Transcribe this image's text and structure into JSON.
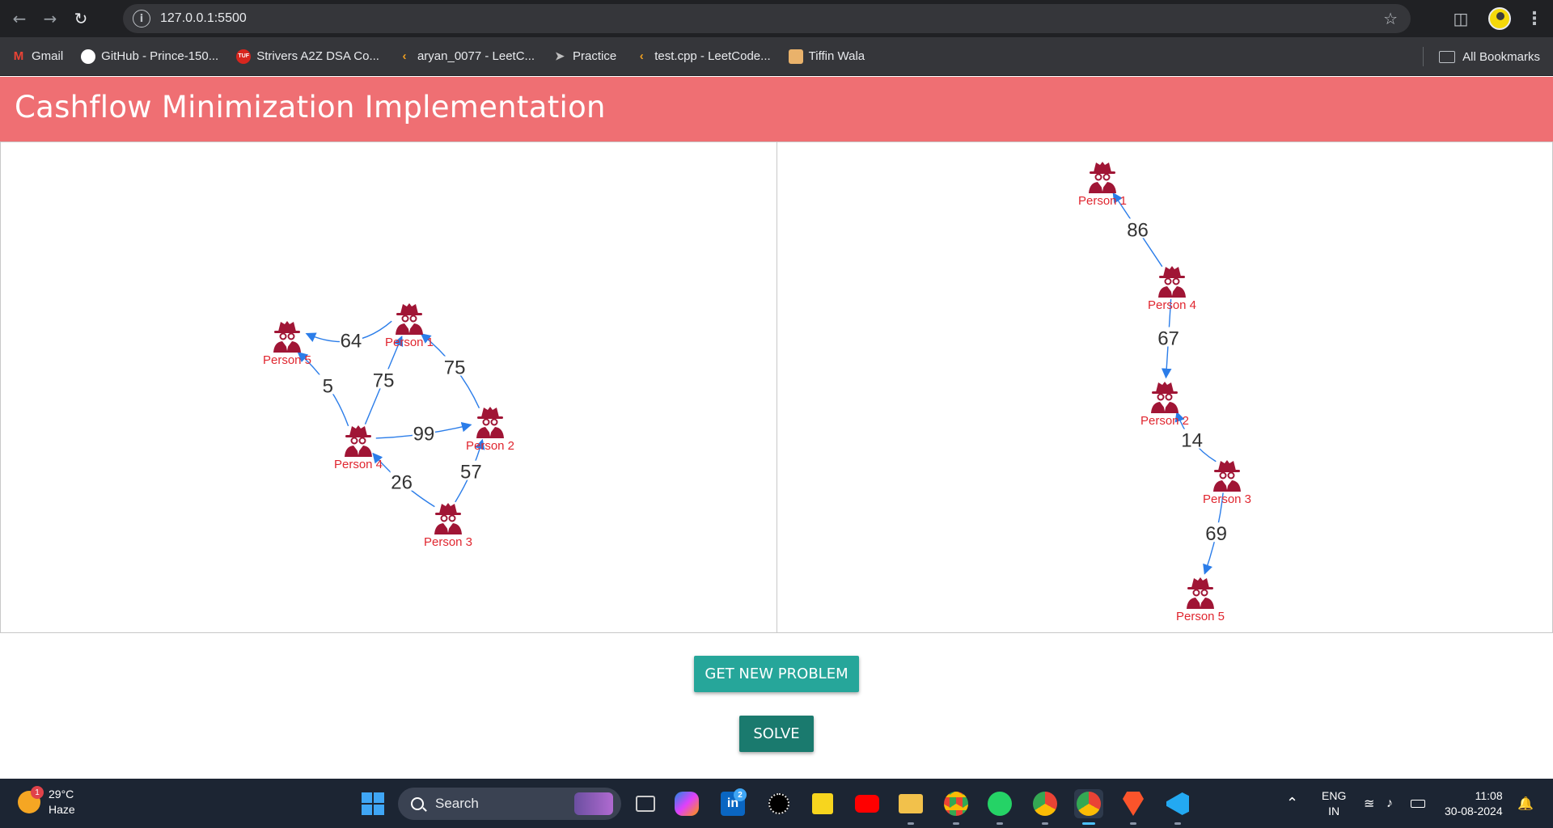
{
  "browser": {
    "url": "127.0.0.1:5500",
    "bookmarks": [
      {
        "label": "Gmail",
        "icon": "gmail-icon",
        "color": "#ea4335",
        "glyph": "M"
      },
      {
        "label": "GitHub - Prince-150...",
        "icon": "github-icon",
        "color": "#ffffff",
        "glyph": ""
      },
      {
        "label": "Strivers A2Z DSA Co...",
        "icon": "tuf-icon",
        "color": "#d7261e",
        "glyph": "TUF"
      },
      {
        "label": "aryan_0077 - LeetC...",
        "icon": "leetcode-icon",
        "color": "#f0a020",
        "glyph": ""
      },
      {
        "label": "Practice",
        "icon": "rocket-icon",
        "color": "#c0c0c0",
        "glyph": ""
      },
      {
        "label": "test.cpp - LeetCode...",
        "icon": "leetcode-icon",
        "color": "#f0a020",
        "glyph": ""
      },
      {
        "label": "Tiffin Wala",
        "icon": "tiffin-icon",
        "color": "#e9b26b",
        "glyph": ""
      }
    ],
    "all_bookmarks_label": "All Bookmarks"
  },
  "app": {
    "title": "Cashflow Minimization Implementation",
    "new_problem_label": "GET NEW PROBLEM",
    "solve_label": "SOLVE",
    "accent_color": "#ef6f73",
    "node_color": "#a01535",
    "edge_color": "#2b7de9"
  },
  "problem_graph": {
    "nodes": [
      {
        "id": "p1",
        "label": "Person 1"
      },
      {
        "id": "p2",
        "label": "Person 2"
      },
      {
        "id": "p3",
        "label": "Person 3"
      },
      {
        "id": "p4",
        "label": "Person 4"
      },
      {
        "id": "p5",
        "label": "Person 5"
      }
    ],
    "edges": [
      {
        "from": "Person 1",
        "to": "Person 5",
        "amount": "64"
      },
      {
        "from": "Person 4",
        "to": "Person 1",
        "amount": "75"
      },
      {
        "from": "Person 2",
        "to": "Person 1",
        "amount": "75"
      },
      {
        "from": "Person 4",
        "to": "Person 5",
        "amount": "5"
      },
      {
        "from": "Person 4",
        "to": "Person 2",
        "amount": "99"
      },
      {
        "from": "Person 3",
        "to": "Person 4",
        "amount": "26"
      },
      {
        "from": "Person 3",
        "to": "Person 2",
        "amount": "57"
      }
    ]
  },
  "solution_graph": {
    "nodes": [
      {
        "id": "s1",
        "label": "Person 1"
      },
      {
        "id": "s4",
        "label": "Person 4"
      },
      {
        "id": "s2",
        "label": "Person 2"
      },
      {
        "id": "s3",
        "label": "Person 3"
      },
      {
        "id": "s5",
        "label": "Person 5"
      }
    ],
    "edges": [
      {
        "from": "Person 4",
        "to": "Person 1",
        "amount": "86"
      },
      {
        "from": "Person 4",
        "to": "Person 2",
        "amount": "67"
      },
      {
        "from": "Person 3",
        "to": "Person 2",
        "amount": "14"
      },
      {
        "from": "Person 3",
        "to": "Person 5",
        "amount": "69"
      }
    ]
  },
  "taskbar": {
    "weather_temp": "29°C",
    "weather_desc": "Haze",
    "weather_badge": "1",
    "search_label": "Search",
    "linkedin_badge": "2",
    "language_top": "ENG",
    "language_bottom": "IN",
    "time": "11:08",
    "date": "30-08-2024"
  }
}
